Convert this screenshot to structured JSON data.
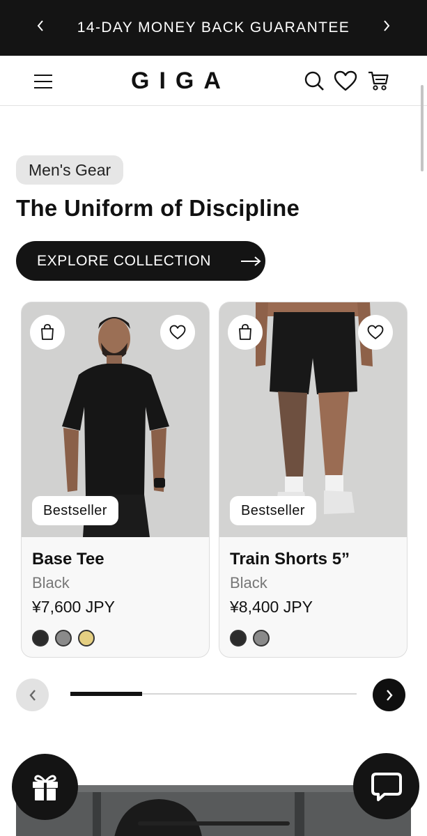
{
  "announcement": {
    "text": "14-DAY MONEY BACK GUARANTEE",
    "prev_icon": "chevron-left-icon",
    "next_icon": "chevron-right-icon"
  },
  "header": {
    "logo": "GIGA",
    "icons": [
      "menu-icon",
      "search-icon",
      "heart-icon",
      "cart-icon"
    ]
  },
  "hero": {
    "tag": "Men's Gear",
    "headline": "The Uniform of Discipline",
    "cta_label": "EXPLORE COLLECTION",
    "cta_icon": "arrow-right-icon"
  },
  "products": [
    {
      "badge": "Bestseller",
      "name": "Base Tee",
      "color": "Black",
      "price": "¥7,600 JPY",
      "swatches": [
        "#2b2b2b",
        "#8a8a8a",
        "#e5cf82"
      ]
    },
    {
      "badge": "Bestseller",
      "name": "Train Shorts 5”",
      "color": "Black",
      "price": "¥8,400 JPY",
      "swatches": [
        "#2b2b2b",
        "#8a8a8a"
      ]
    }
  ],
  "carousel": {
    "progress": 0.25
  },
  "floating": {
    "gift_icon": "gift-icon",
    "chat_icon": "chat-icon"
  }
}
